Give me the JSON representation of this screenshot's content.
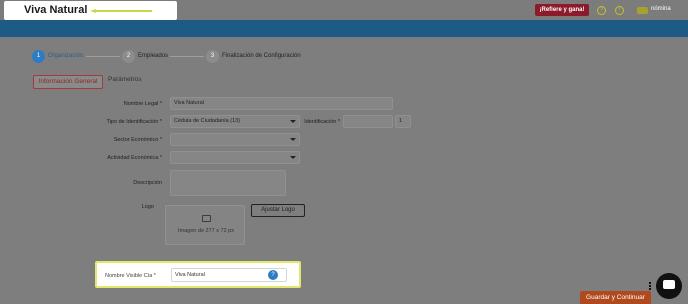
{
  "header": {
    "company_name": "Viva Natural",
    "refer_label": "¡Refiere y gana!",
    "help_icon": "?",
    "bell_icon": "!",
    "brand_name": "nómina"
  },
  "steps": [
    {
      "number": "1",
      "label": "Organización",
      "active": true
    },
    {
      "number": "2",
      "label": "Empleados",
      "active": false
    },
    {
      "number": "3",
      "label": "Finalización de Configuración",
      "active": false
    }
  ],
  "tabs": {
    "general": "Información General",
    "params": "Parámetros"
  },
  "form": {
    "legal_name_label": "Nombre Legal *",
    "legal_name_value": "Viva Natural",
    "id_type_label": "Tipo de Identificación *",
    "id_type_value": "Cédula de Ciudadanía (13)",
    "identification_label": "Identificación *",
    "identification_value": "",
    "dv_value": "1",
    "sector_label": "Sector Económico *",
    "sector_value": "",
    "activity_label": "Actividad Económica *",
    "activity_value": "",
    "description_label": "Descripción",
    "description_value": "",
    "logo_label": "Logo",
    "logo_hint": "Imagen de 277 x 72 px",
    "adjust_logo_label": "Ajustar Logo",
    "visible_name_label": "Nombre Visible Cía *",
    "visible_name_value": "Viva Natural",
    "info_icon": "?"
  },
  "footer": {
    "save_label": "Guardar y Continuar"
  },
  "colors": {
    "active_step": "#2d7cc4",
    "inactive_step": "#8c8c8c",
    "highlight_border": "#e3e86c",
    "accent": "#b04a1e"
  }
}
